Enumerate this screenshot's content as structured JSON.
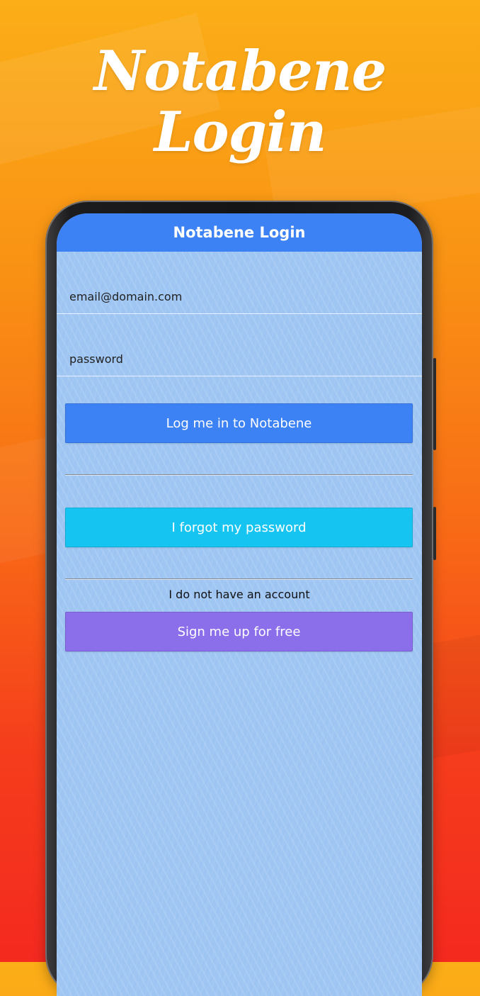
{
  "promo": {
    "title_line1": "Notabene",
    "title_line2": "Login"
  },
  "app": {
    "navbar_title": "Notabene Login",
    "email_placeholder": "email@domain.com",
    "password_placeholder": "password",
    "login_button": "Log me in to Notabene",
    "forgot_button": "I forgot my password",
    "no_account_text": "I do not have an account",
    "signup_button": "Sign me up for free"
  },
  "colors": {
    "navbar": "#3d82f5",
    "login_button": "#3d82f5",
    "forgot_button": "#16c4f2",
    "signup_button": "#8b6eea",
    "screen_background": "#9fc6f3"
  }
}
